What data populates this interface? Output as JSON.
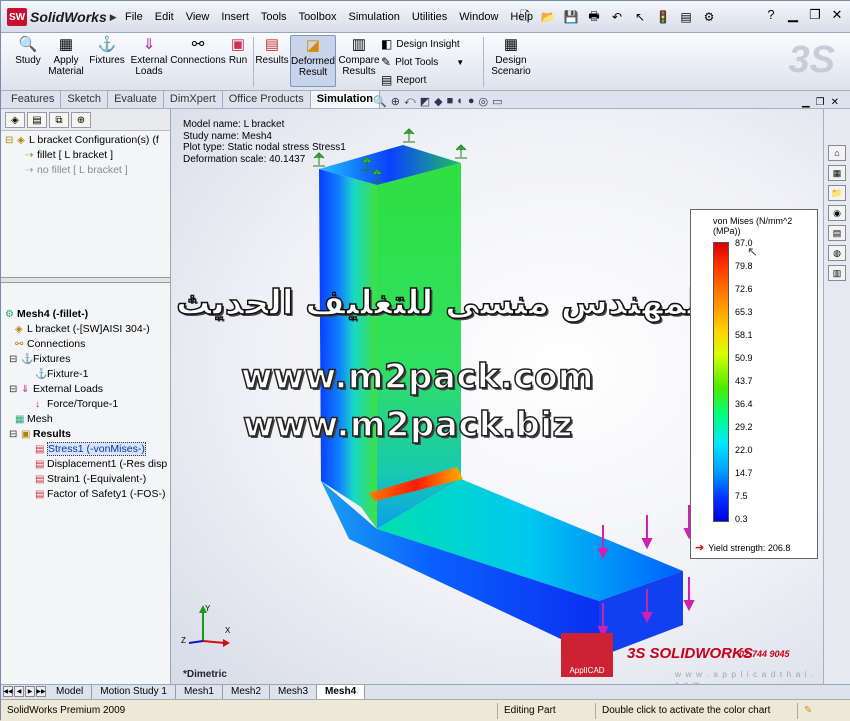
{
  "app": {
    "name": "SolidWorks",
    "menus": [
      "File",
      "Edit",
      "View",
      "Insert",
      "Tools",
      "Toolbox",
      "Simulation",
      "Utilities",
      "Window",
      "Help"
    ]
  },
  "commands": {
    "study": "Study",
    "apply_material": [
      "Apply",
      "Material"
    ],
    "fixtures": "Fixtures",
    "external_loads": [
      "External",
      "Loads"
    ],
    "connections": "Connections",
    "run": "Run",
    "results": "Results",
    "deformed_result": [
      "Deformed",
      "Result"
    ],
    "compare_results": [
      "Compare",
      "Results"
    ],
    "design_insight": "Design Insight",
    "plot_tools": "Plot Tools",
    "report": "Report",
    "design_scenario": [
      "Design",
      "Scenario"
    ]
  },
  "tabs": [
    "Features",
    "Sketch",
    "Evaluate",
    "DimXpert",
    "Office Products",
    "Simulation"
  ],
  "active_tab": "Simulation",
  "config_tree": {
    "root": "L bracket Configuration(s)  (f",
    "items": [
      "fillet [ L bracket ]",
      "no fillet [ L bracket ]"
    ]
  },
  "sim_tree": {
    "root": "Mesh4 (-fillet-)",
    "part": "L bracket (-[SW]AISI 304-)",
    "connections": "Connections",
    "fixtures": "Fixtures",
    "fixture_1": "Fixture-1",
    "external_loads": "External Loads",
    "force_torque": "Force/Torque-1",
    "mesh": "Mesh",
    "results": "Results",
    "result_items": [
      "Stress1 (-vonMises-)",
      "Displacement1 (-Res disp-",
      "Strain1 (-Equivalent-)",
      "Factor of Safety1 (-FOS-)"
    ]
  },
  "plot_info": {
    "model_name": "Model name: L bracket",
    "study_name": "Study name: Mesh4",
    "plot_type": "Plot type: Static nodal stress Stress1",
    "deformation_scale": "Deformation scale: 40.1437"
  },
  "legend": {
    "title": "von Mises (N/mm^2 (MPa))",
    "ticks": [
      "87.0",
      "79.8",
      "72.6",
      "65.3",
      "58.1",
      "50.9",
      "43.7",
      "36.4",
      "29.2",
      "22.0",
      "14.7",
      "7.5",
      "0.3"
    ],
    "yield": "Yield strength: 206.8"
  },
  "view_label": "*Dimetric",
  "watermark": {
    "arabic": "شركة المهندس منسى للتغليف الحديث",
    "url1": "www.m2pack.com",
    "url2": "www.m2pack.biz"
  },
  "branding": {
    "applicad": "ApplICAD",
    "solidworks": "3S SOLIDWORKS",
    "phone": "02-744 9045",
    "website": "w w w . a p p l i c a d t h a i . c o m"
  },
  "bottom_tabs": [
    "Model",
    "Motion Study 1",
    "Mesh1",
    "Mesh2",
    "Mesh3",
    "Mesh4"
  ],
  "active_bottom_tab": "Mesh4",
  "status": {
    "product": "SolidWorks Premium 2009",
    "mode": "Editing Part",
    "hint": "Double click to activate the color chart"
  },
  "colors": {
    "accent": "#c80018",
    "selection": "#d8e4f8"
  }
}
